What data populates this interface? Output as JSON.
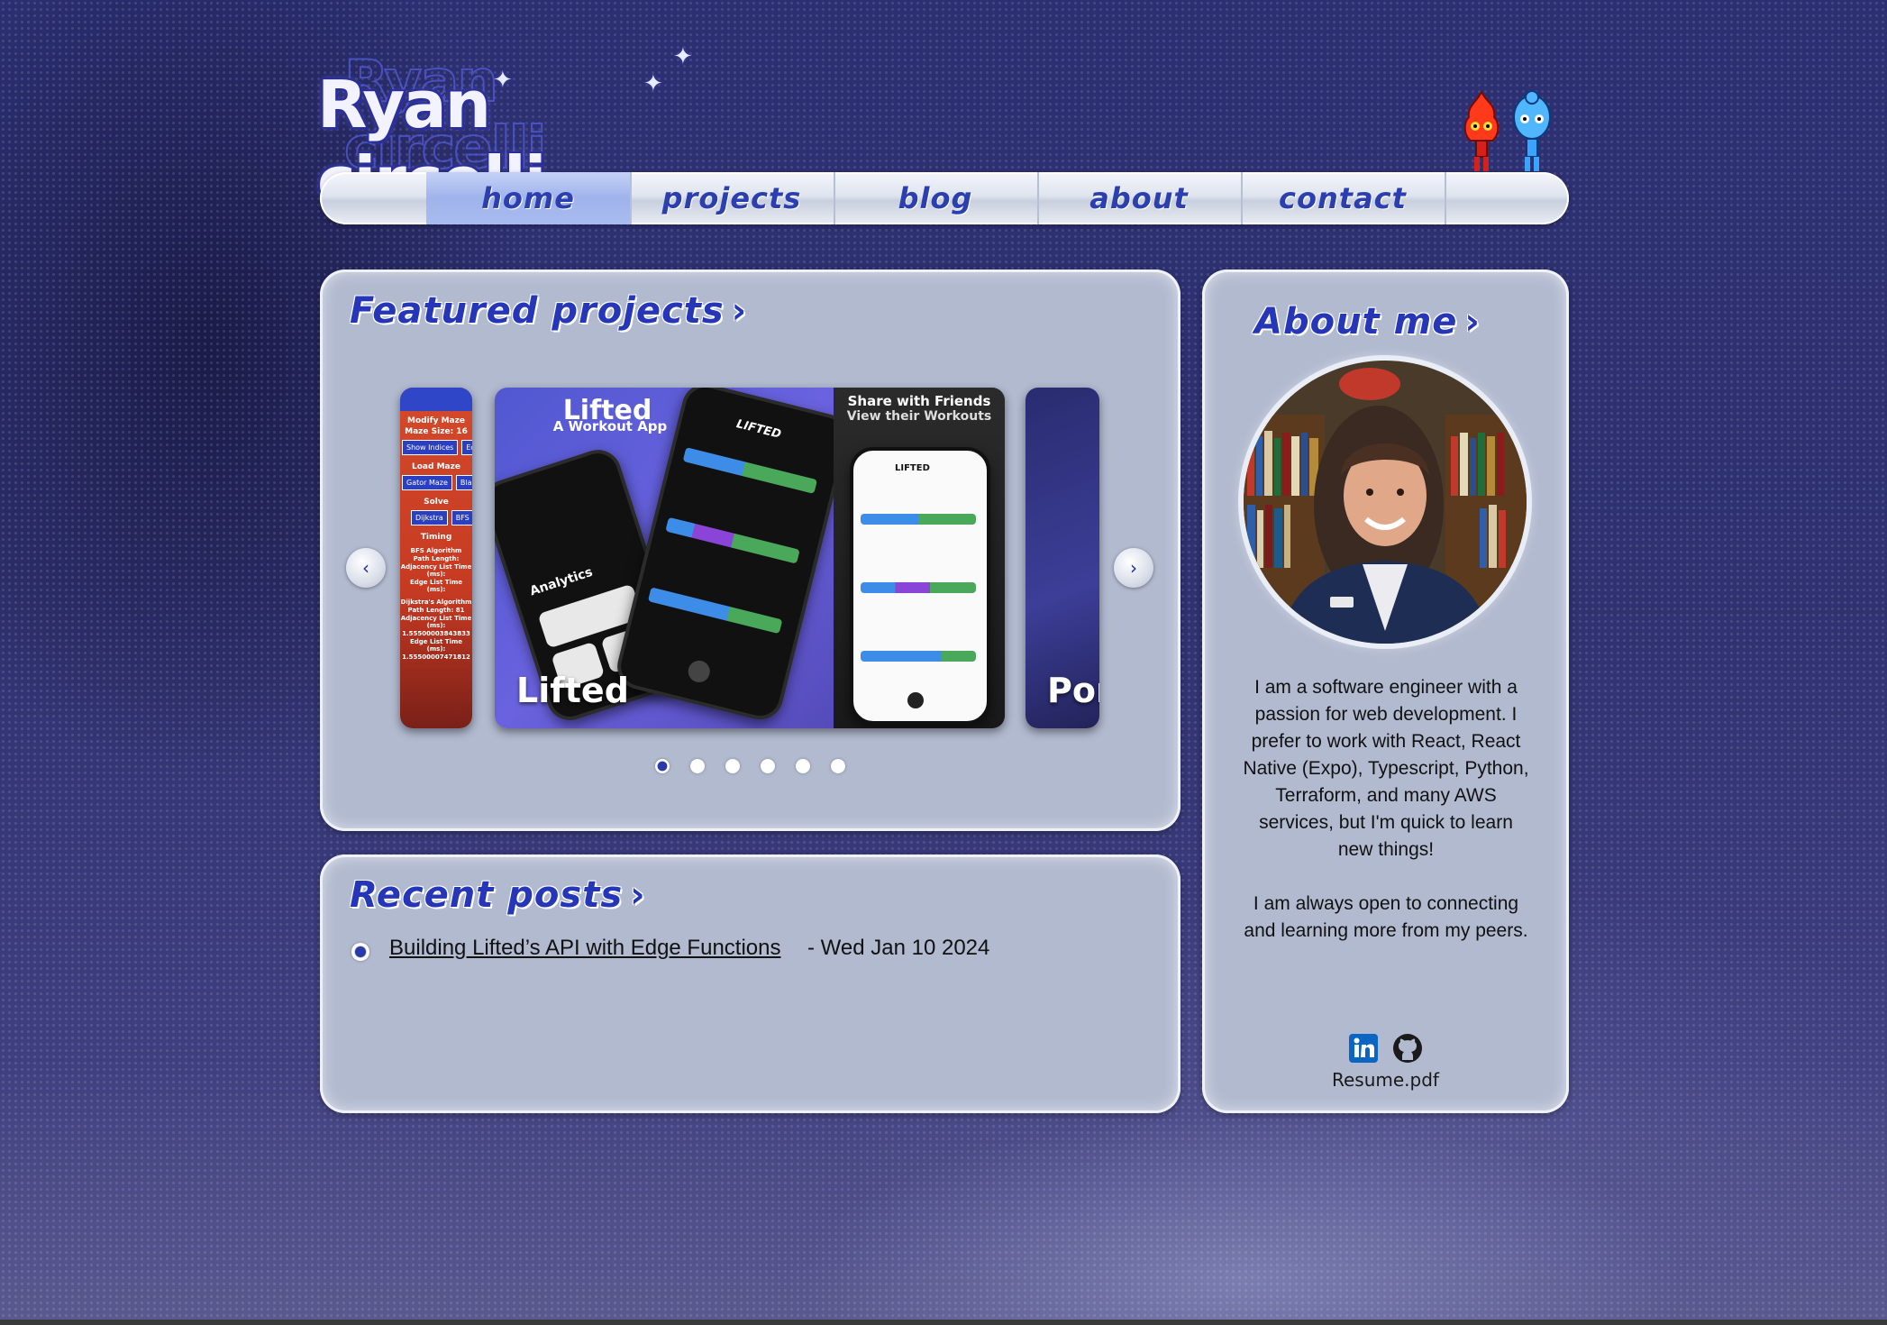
{
  "site": {
    "logo_text": "Ryan circelli"
  },
  "nav": {
    "items": [
      {
        "label": "home",
        "active": true
      },
      {
        "label": "projects",
        "active": false
      },
      {
        "label": "blog",
        "active": false
      },
      {
        "label": "about",
        "active": false
      },
      {
        "label": "contact",
        "active": false
      }
    ]
  },
  "featured": {
    "title": "Featured projects",
    "chevron": "›",
    "prev_icon": "‹",
    "next_icon": "›",
    "cards": [
      {
        "label": "",
        "texts": [
          "Modify Maze",
          "Maze Size: 16",
          "Show Indices",
          "Edit M",
          "Load Maze",
          "Gator Maze",
          "Blank M",
          "Solve",
          "Dijkstra",
          "BFS",
          "Timing",
          "BFS Algorithm",
          "Path Length:",
          "Adjacency List Time (ms):",
          "Edge List Time (ms):",
          "Dijkstra's Algorithm",
          "Path Length: 81",
          "Adjacency List Time (ms):",
          "1.55500003843833",
          "Edge List Time (ms):",
          "1.55500007471812"
        ]
      },
      {
        "label": "Lifted",
        "title": "Lifted",
        "subtitle": "A Workout App",
        "share_title": "Share with Friends",
        "share_subtitle": "View their Workouts",
        "app_header": "LIFTED",
        "analytics": "Analytics"
      },
      {
        "label": "Por"
      }
    ],
    "dots_count": 6,
    "active_dot": 0
  },
  "recent": {
    "title": "Recent posts",
    "chevron": "›",
    "posts": [
      {
        "title": "Building Lifted’s API with Edge Functions",
        "date": "- Wed Jan 10 2024"
      }
    ]
  },
  "about": {
    "title": "About me",
    "chevron": "›",
    "paragraph1": "I am a software engineer with a passion for web development. I prefer to work with React, React Native (Expo), Typescript, Python, Terraform, and many AWS services, but I'm quick to learn new things!",
    "paragraph2": "I am always open to connecting and learning more from my peers.",
    "resume_label": "Resume.pdf",
    "social": [
      {
        "name": "linkedin-icon",
        "color": "#0a66c2",
        "glyph": "in"
      },
      {
        "name": "github-icon",
        "color": "#1a1a1a"
      }
    ]
  },
  "colors": {
    "accent": "#2536b8",
    "panel": "#b2bad0",
    "background": "#2f3170"
  }
}
